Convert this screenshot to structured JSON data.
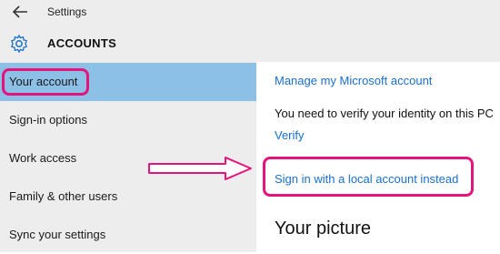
{
  "window": {
    "title": "Settings",
    "back_icon": "arrow-left-icon"
  },
  "header": {
    "icon": "gear-icon",
    "title": "ACCOUNTS"
  },
  "sidebar": {
    "items": [
      {
        "label": "Your account",
        "selected": true
      },
      {
        "label": "Sign-in options",
        "selected": false
      },
      {
        "label": "Work access",
        "selected": false
      },
      {
        "label": "Family & other users",
        "selected": false
      },
      {
        "label": "Sync your settings",
        "selected": false
      }
    ]
  },
  "main": {
    "manage_link": "Manage my Microsoft account",
    "verify_text": "You need to verify your identity on this PC",
    "verify_link": "Verify",
    "local_account_link": "Sign in with a local account instead",
    "picture_heading": "Your picture"
  },
  "colors": {
    "accent": "#1a6fc9",
    "selected": "#8cc0e6",
    "highlight": "#e4147c",
    "sidebar_bg": "#ededed"
  }
}
